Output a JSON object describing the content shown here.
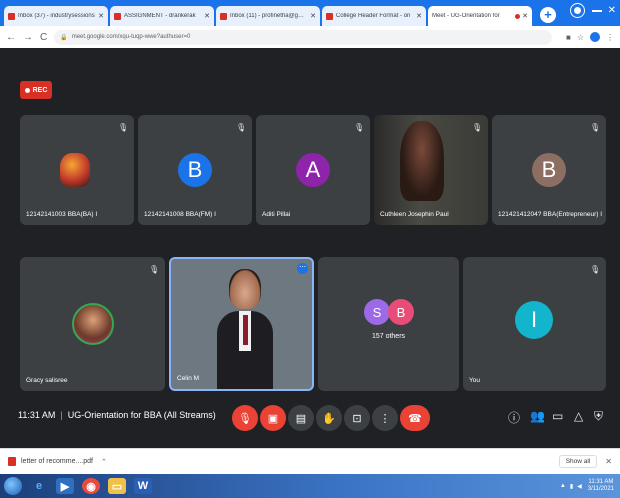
{
  "browser": {
    "tabs": [
      {
        "title": "Inbox (37) - industrysessions",
        "favicon": "gmail-icon",
        "active": false
      },
      {
        "title": "ASSIGNMENT - drankerak",
        "favicon": "gmail-icon",
        "active": false
      },
      {
        "title": "Inbox (11) - profinetha@gmail",
        "favicon": "gmail-icon",
        "active": false
      },
      {
        "title": "College Header Format - ori",
        "favicon": "gmail-icon",
        "active": false
      },
      {
        "title": "Meet - UG-Orientation for",
        "favicon": "meet-icon",
        "active": true
      }
    ],
    "new_tab": "+",
    "url": "meet.google.com/xqu-tuqp-wwe?authuser=0",
    "nav": {
      "back": "←",
      "forward": "→",
      "reload": "C"
    }
  },
  "meet": {
    "rec_label": "REC",
    "participants": [
      {
        "name": "12142141003 BBA(BA) I",
        "initial": "",
        "avatar_color": "#3c4043",
        "kind": "photo"
      },
      {
        "name": "12142141008 BBA(FM) I",
        "initial": "B",
        "avatar_color": "#1a73e8",
        "kind": "letter"
      },
      {
        "name": "Aditi Pillai",
        "initial": "A",
        "avatar_color": "#8e24aa",
        "kind": "letter"
      },
      {
        "name": "Cuthleen Josephin Paul",
        "initial": "",
        "avatar_color": "#3c4043",
        "kind": "video"
      },
      {
        "name": "12142141204? BBA(Entrepreneur) I",
        "initial": "B",
        "avatar_color": "#8d6e63",
        "kind": "letter"
      },
      {
        "name": "Gracy salisree",
        "initial": "",
        "avatar_color": "#3c4043",
        "kind": "photo-round"
      },
      {
        "name": "Celin M",
        "initial": "",
        "avatar_color": "#3c4043",
        "kind": "video-main"
      },
      {
        "name": "157 others",
        "initial": "",
        "avatar_color": "#3c4043",
        "kind": "others"
      },
      {
        "name": "You",
        "initial": "I",
        "avatar_color": "#12b5cb",
        "kind": "letter"
      }
    ],
    "others_avatars": [
      {
        "initial": "S",
        "color": "#9c6ae6"
      },
      {
        "initial": "B",
        "color": "#e84c77"
      }
    ],
    "time": "11:31 AM",
    "meeting_title": "UG-Orientation for BBA (All Streams)"
  },
  "downloads": {
    "file": "letter of recomme....pdf",
    "show_all": "Show all"
  },
  "taskbar": {
    "time": "11:31 AM",
    "date": "3/11/2021"
  }
}
